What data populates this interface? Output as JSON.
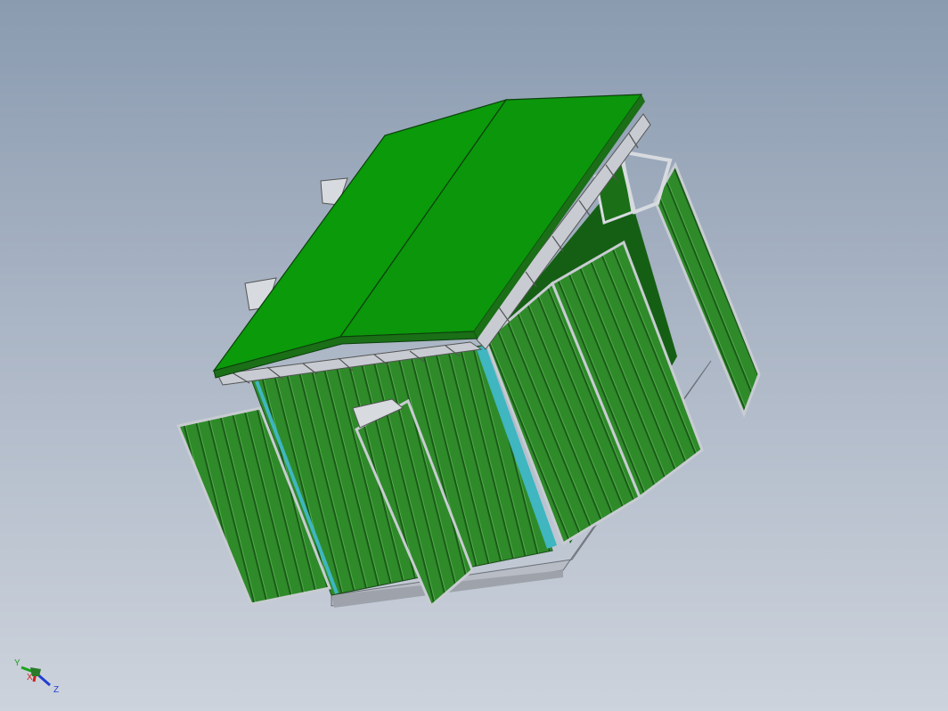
{
  "viewport": {
    "background_top": "#8a9bb0",
    "background_bottom": "#cdd3dc"
  },
  "model": {
    "roof_color": "#0a9a0a",
    "panel_color": "#2f8a2a",
    "panel_dark_color": "#1f6b1c",
    "frame_color": "#c8ccd2",
    "glass_color": "#3fb6c0",
    "base_color": "#b8bcc4"
  },
  "triad": {
    "x_label": "X",
    "y_label": "Y",
    "z_label": "Z",
    "x_color": "#d21f1f",
    "y_color": "#1aa31a",
    "z_color": "#1f3fd2"
  }
}
